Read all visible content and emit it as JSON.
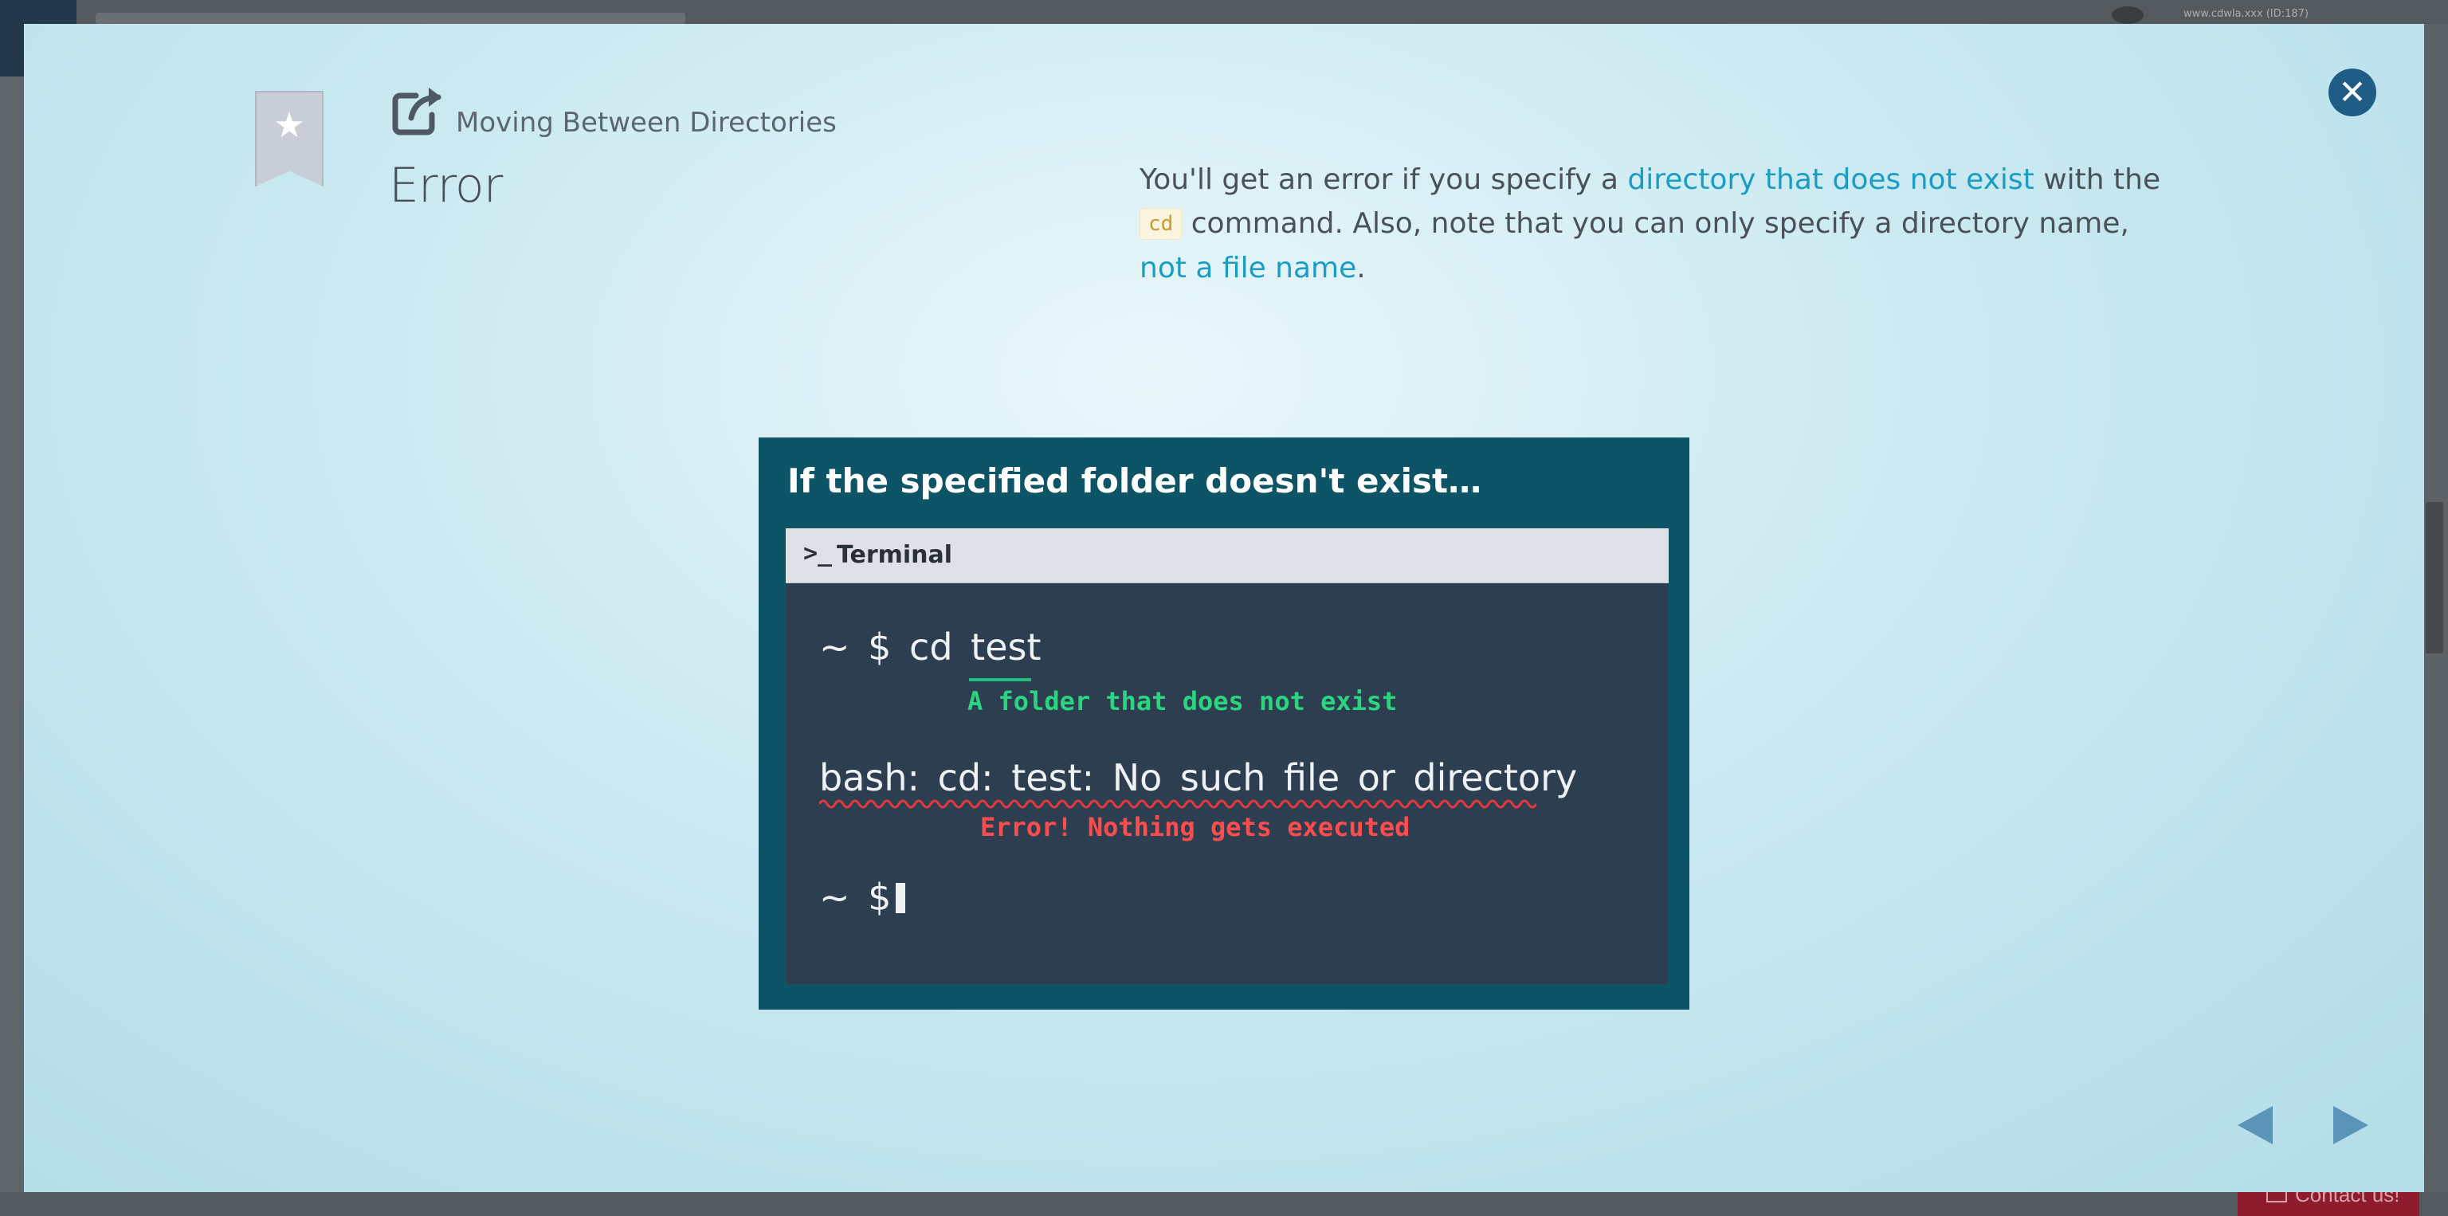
{
  "background": {
    "user_label": "www.cdwla.xxx (ID:187)",
    "contact_label": "Contact us!"
  },
  "modal": {
    "breadcrumb": "Moving Between Directories",
    "title": "Error",
    "description": {
      "part1": "You'll get an error if you specify a ",
      "link1": "directory that does not exist",
      "part2": " with the ",
      "code": "cd",
      "part3": " command. Also, note that you can only specify a directory name, ",
      "link2": "not a file name",
      "part4": "."
    },
    "close_icon": "close-icon",
    "colors": {
      "link": "#1a9dc4",
      "close_button": "#1f5d86",
      "accent_green": "#2bd47f",
      "accent_red": "#ff4d4d"
    }
  },
  "illustration": {
    "title": "If the specified folder doesn't exist…",
    "terminal": {
      "prompt_glyph": ">_",
      "title": "Terminal",
      "line1_prefix": "~ $ cd ",
      "line1_arg": "test",
      "annotation1": "A folder that does not exist",
      "line2": "bash: cd: test: No such file or directory",
      "annotation2": "Error! Nothing gets executed",
      "line3": "~ $"
    }
  },
  "navigation": {
    "prev_icon": "triangle-left-icon",
    "next_icon": "triangle-right-icon"
  }
}
